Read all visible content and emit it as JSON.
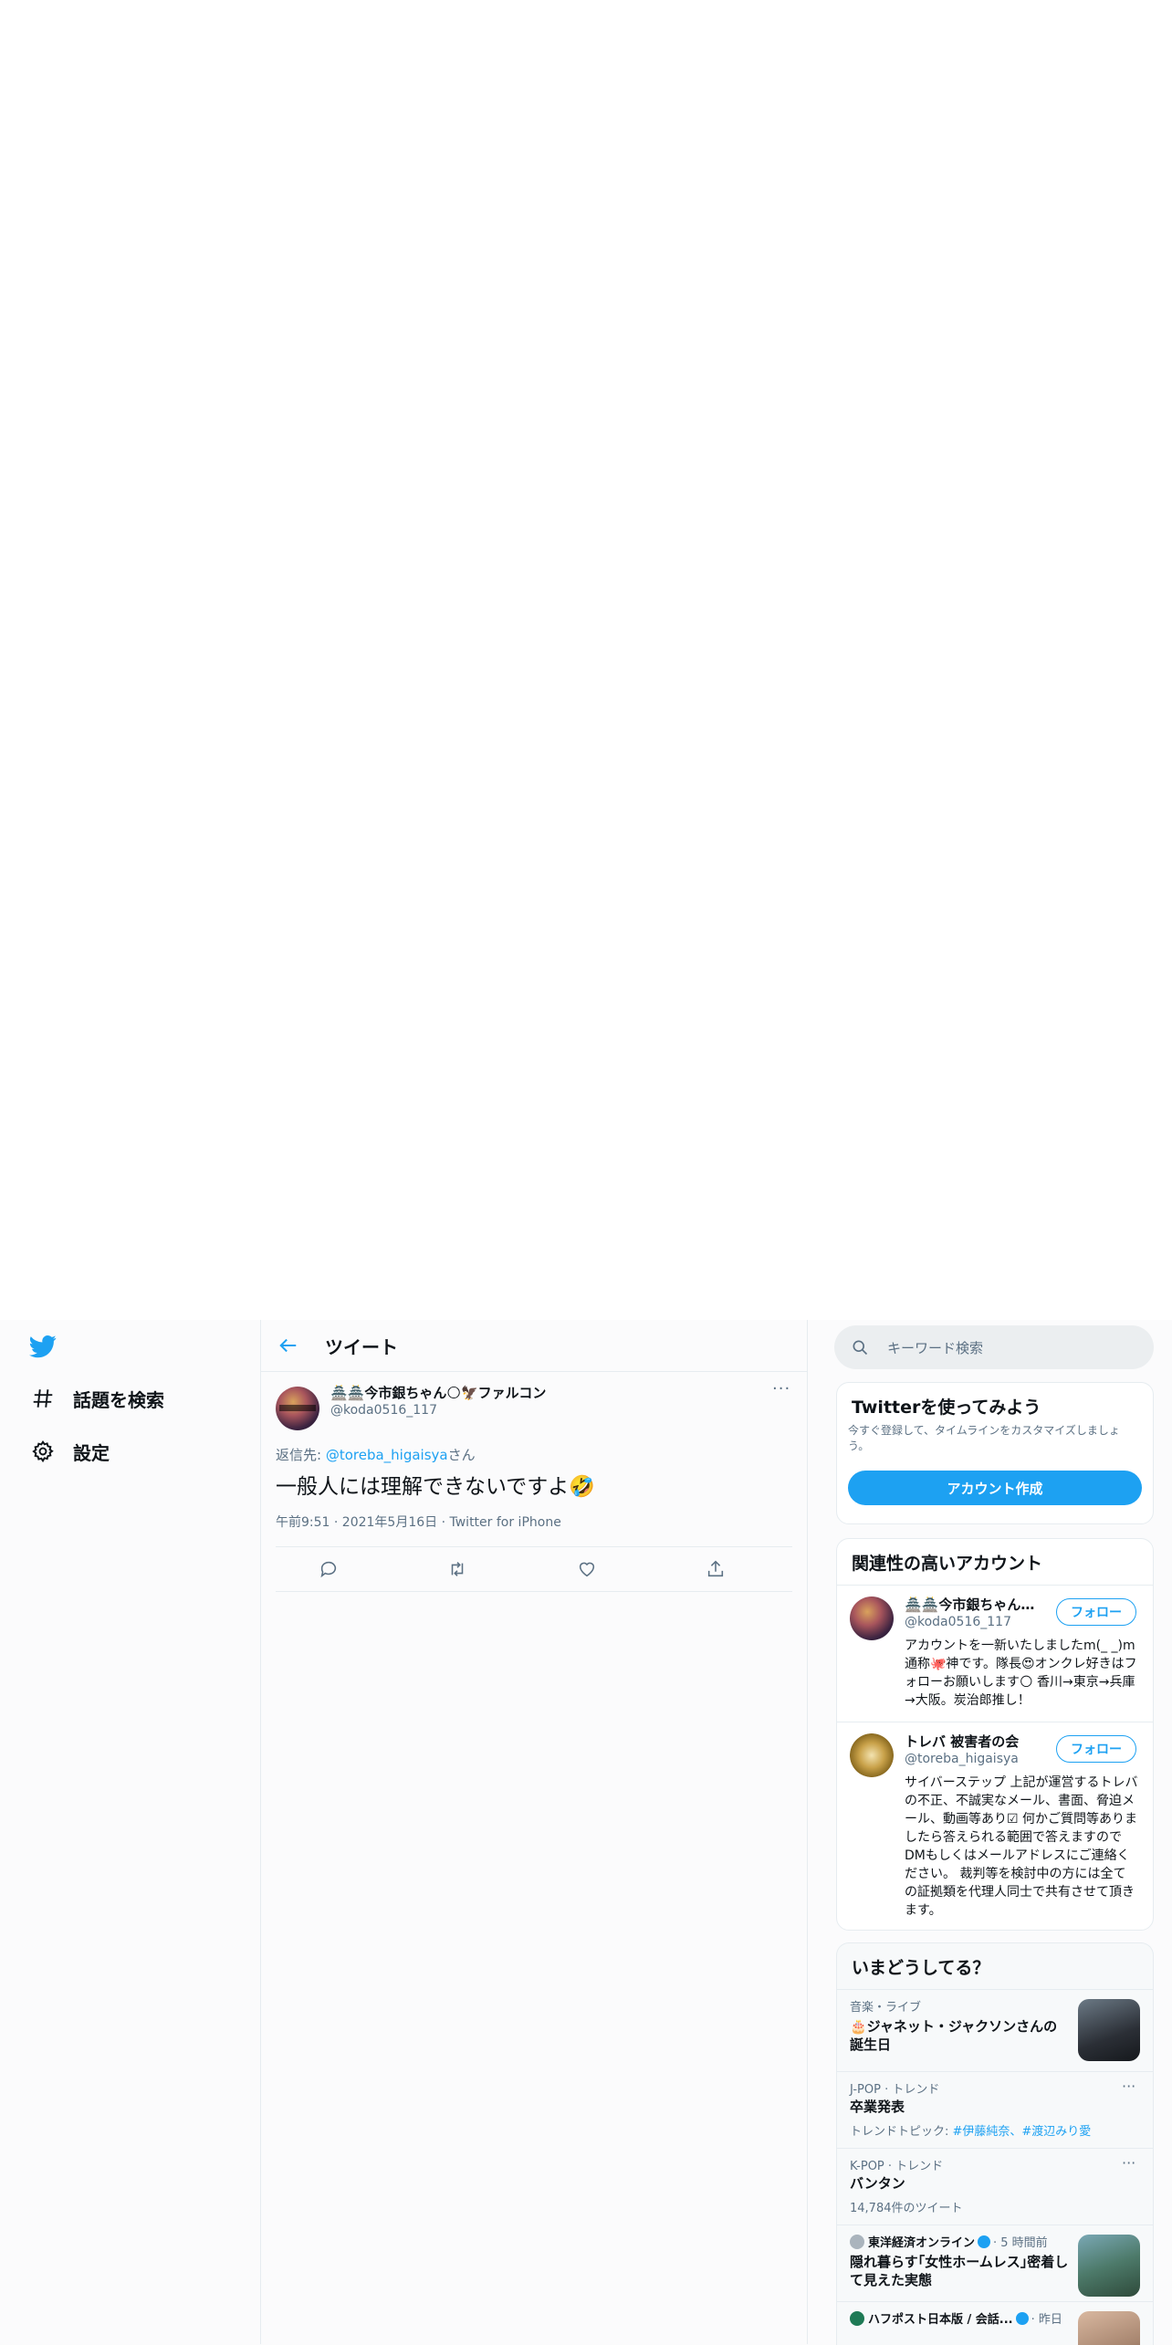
{
  "nav": {
    "explore_label": "話題を検索",
    "settings_label": "設定"
  },
  "header": {
    "title": "ツイート"
  },
  "tweet": {
    "author_name": "🏯🏯今市銀ちゃん🌕🦅ファルコン",
    "author_handle": "@koda0516_117",
    "reply_prefix": "返信先: ",
    "reply_handle": "@toreba_higaisya",
    "reply_suffix": "さん",
    "text": "一般人には理解できないですよ🤣",
    "meta": "午前9:51 · 2021年5月16日 · Twitter for iPhone",
    "more": "···"
  },
  "search": {
    "placeholder": "キーワード検索"
  },
  "signup": {
    "title": "Twitterを使ってみよう",
    "description": "今すぐ登録して、タイムラインをカスタマイズしましょう。",
    "button": "アカウント作成"
  },
  "related": {
    "title": "関連性の高いアカウント",
    "accounts": [
      {
        "name": "🏯🏯今市銀ちゃん🌕🦅ファルコン",
        "handle": "@koda0516_117",
        "follow": "フォロー",
        "bio": "アカウントを一新いたしましたm(_ _)m通称🐙神です。隊長😍オンクレ好きはフォローお願いします🌕 香川→東京→兵庫→大阪。炭治郎推し！"
      },
      {
        "name": "トレバ 被害者の会",
        "handle": "@toreba_higaisya",
        "follow": "フォロー",
        "bio": "サイバーステップ 上記が運営するトレバの不正、不誠実なメール、書面、脅迫メール、動画等あり☑ 何かご質問等ありましたら答えられる範囲で答えますのでDMもしくはメールアドレスにご連絡ください。 裁判等を検討中の方には全ての証拠類を代理人同士で共有させて頂きます。"
      }
    ]
  },
  "trends": {
    "title": "いまどうしてる？",
    "items": [
      {
        "category": "音楽・ライブ",
        "title": "🎂ジャネット・ジャクソンさんの誕生日"
      },
      {
        "category": "J-POP · トレンド",
        "title": "卒業発表",
        "sub_prefix": "トレンドトピック: ",
        "tags": "#伊藤純奈、#渡辺みり愛"
      },
      {
        "category": "K-POP · トレンド",
        "title": "バンタン",
        "sub": "14,784件のツイート"
      },
      {
        "source": "東洋経済オンライン",
        "time": "· 5 時間前",
        "title": "隠れ暮らす｢女性ホームレス｣密着して見えた実態"
      },
      {
        "source": "ハフポスト日本版 / 会話...",
        "time": "· 昨日"
      }
    ]
  },
  "colors": {
    "accent": "#1da1f2",
    "text": "#0f1419",
    "muted": "#5b7083",
    "border": "#e6ecf0"
  }
}
